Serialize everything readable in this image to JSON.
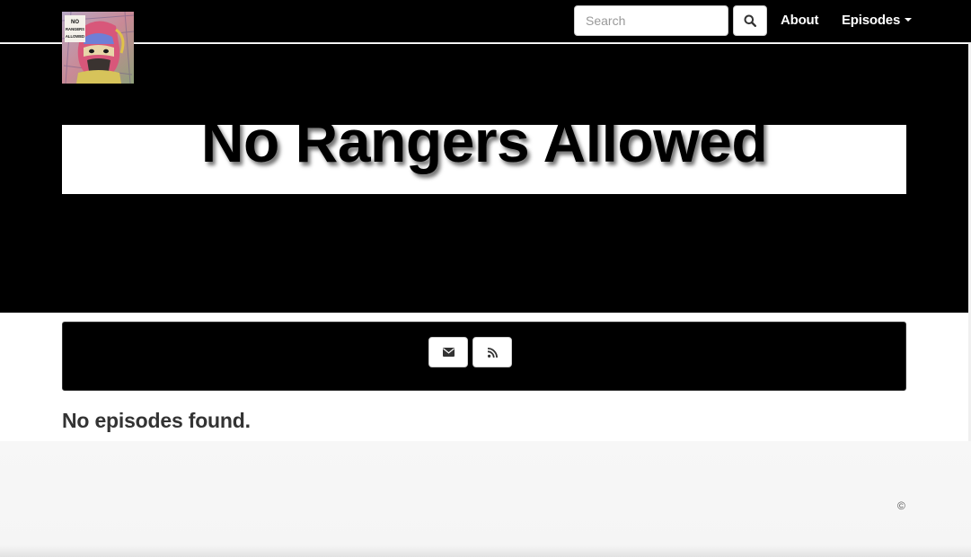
{
  "nav": {
    "search_placeholder": "Search",
    "search_value": "",
    "about_label": "About",
    "episodes_label": "Episodes"
  },
  "logo": {
    "alt": "No Rangers Allowed",
    "line1": "NO",
    "line2": "RANGERS",
    "line3": "ALLOWED"
  },
  "header": {
    "title": "No Rangers Allowed"
  },
  "subscribe": {
    "email_icon": "envelope-icon",
    "rss_icon": "rss-icon"
  },
  "content": {
    "message": "No episodes found."
  },
  "footer": {
    "copyright": "©"
  },
  "colors": {
    "header_bg": "#000000",
    "banner_bg": "#ffffff",
    "text_dark": "#333333",
    "footer_bg": "#f5f5f5"
  }
}
